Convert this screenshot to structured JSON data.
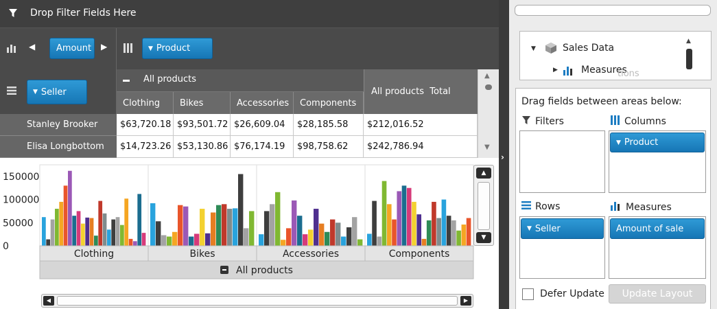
{
  "filter_bar": {
    "label": "Drop Filter Fields Here"
  },
  "data_bar": {
    "measure": "Amount",
    "column_field": "Product",
    "row_field": "Seller"
  },
  "grid": {
    "group_header": "All products",
    "total_header": "All products  Total",
    "columns": [
      "Clothing",
      "Bikes",
      "Accessories",
      "Components"
    ],
    "rows": [
      {
        "name": "Stanley Brooker",
        "values": [
          "$63,720.18",
          "$93,501.72",
          "$26,609.04",
          "$28,185.58"
        ],
        "total": "$212,016.52"
      },
      {
        "name": "Elisa Longbottom",
        "values": [
          "$14,723.26",
          "$53,130.86",
          "$76,174.19",
          "$98,758.62"
        ],
        "total": "$242,786.94"
      }
    ]
  },
  "colors": {
    "accent": "#1a7dc4",
    "dark": "#3f3f3f"
  },
  "chart_data": {
    "type": "bar",
    "categories": [
      "Clothing",
      "Bikes",
      "Accessories",
      "Components"
    ],
    "y_ticks": [
      "150000",
      "100000",
      "50000",
      "0"
    ],
    "ylim": [
      0,
      175000
    ],
    "group_label": "All products",
    "palette": [
      "#29a3dd",
      "#3e3e3e",
      "#a3a3a3",
      "#80b832",
      "#f5a623",
      "#e9552b",
      "#9b59b6",
      "#1b6d8f",
      "#d63a7a",
      "#f3d130",
      "#4f2f8f",
      "#e67e22",
      "#2e8b57",
      "#c0392b",
      "#7f8c8d"
    ],
    "series_values": [
      [
        62000,
        14000,
        57000,
        80000,
        95000,
        130000,
        162000,
        65000,
        75000,
        48000,
        61000,
        60000,
        22000,
        97000,
        70000,
        35000,
        57000,
        62000,
        45000,
        102000,
        15000,
        10000,
        112000,
        28000
      ],
      [
        92000,
        53000,
        23000,
        20000,
        30000,
        88000,
        85000,
        20000,
        26000,
        80000,
        27000,
        72000,
        88000,
        90000,
        80000,
        81000,
        155000,
        38000,
        75000
      ],
      [
        25000,
        75000,
        90000,
        116000,
        13000,
        38000,
        98000,
        65000,
        25000,
        35000,
        80000,
        48000,
        30000,
        57000,
        50000,
        20000,
        40000,
        62000,
        14000
      ],
      [
        26000,
        97000,
        20000,
        140000,
        90000,
        57000,
        118000,
        130000,
        125000,
        95000,
        68000,
        15000,
        55000,
        95000,
        60000,
        100000,
        65000,
        55000,
        33000,
        46000,
        60000
      ]
    ]
  },
  "field_list": {
    "search_placeholder": "",
    "tree_root": "Sales Data",
    "tree_child": "Measures",
    "tree_ghost": "tions",
    "drag_hint": "Drag fields between areas below:",
    "filters_label": "Filters",
    "columns_label": "Columns",
    "columns_item": "Product",
    "rows_label": "Rows",
    "rows_item": "Seller",
    "measures_label": "Measures",
    "measures_item": "Amount of sale",
    "defer_label": "Defer Update",
    "update_label": "Update Layout"
  }
}
